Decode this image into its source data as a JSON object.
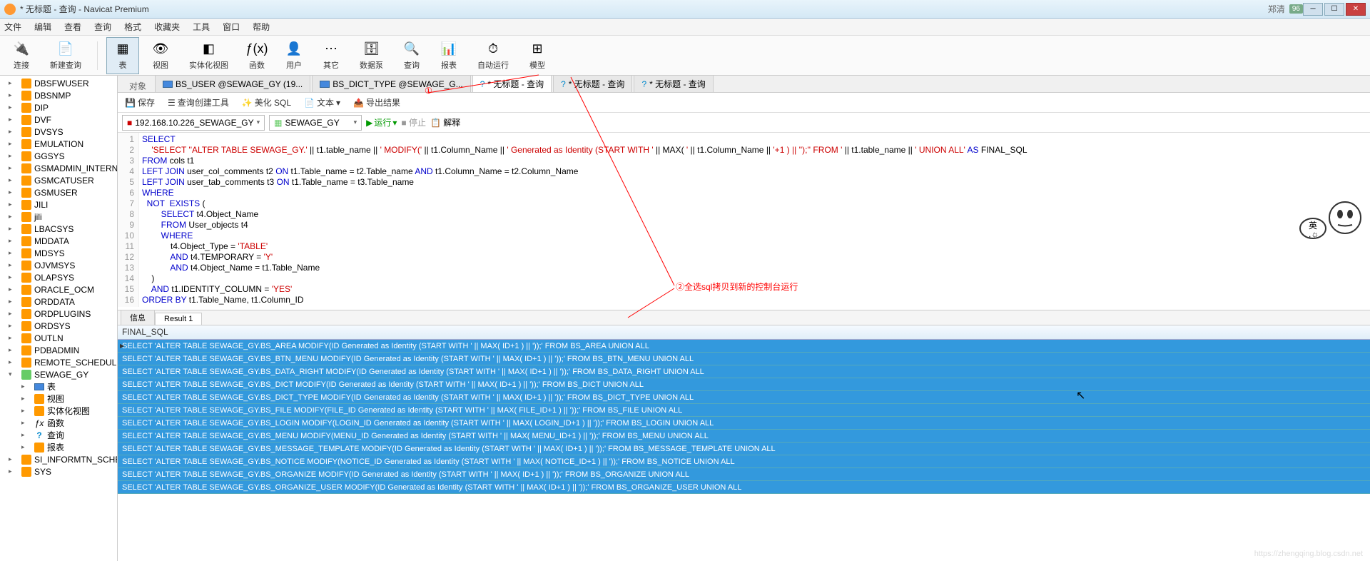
{
  "window": {
    "title": "* 无标题 - 查询 - Navicat Premium"
  },
  "menubar": [
    "文件",
    "编辑",
    "查看",
    "查询",
    "格式",
    "收藏夹",
    "工具",
    "窗口",
    "帮助"
  ],
  "user": {
    "name": "郑清",
    "badge": "96"
  },
  "toolbar": [
    {
      "icon": "🔌",
      "label": "连接"
    },
    {
      "icon": "📄",
      "label": "新建查询"
    },
    {
      "icon": "▦",
      "label": "表",
      "active": true
    },
    {
      "icon": "👁",
      "label": "视图"
    },
    {
      "icon": "◧",
      "label": "实体化视图"
    },
    {
      "icon": "ƒ(x)",
      "label": "函数"
    },
    {
      "icon": "👤",
      "label": "用户"
    },
    {
      "icon": "⋯",
      "label": "其它"
    },
    {
      "icon": "🗄",
      "label": "数据泵"
    },
    {
      "icon": "🔍",
      "label": "查询"
    },
    {
      "icon": "📊",
      "label": "报表"
    },
    {
      "icon": "⏱",
      "label": "自动运行"
    },
    {
      "icon": "⊞",
      "label": "模型"
    }
  ],
  "sidebar": [
    {
      "label": "DBSFWUSER",
      "t": "db"
    },
    {
      "label": "DBSNMP",
      "t": "db"
    },
    {
      "label": "DIP",
      "t": "db"
    },
    {
      "label": "DVF",
      "t": "db"
    },
    {
      "label": "DVSYS",
      "t": "db"
    },
    {
      "label": "EMULATION",
      "t": "db"
    },
    {
      "label": "GGSYS",
      "t": "db"
    },
    {
      "label": "GSMADMIN_INTERN",
      "t": "db"
    },
    {
      "label": "GSMCATUSER",
      "t": "db"
    },
    {
      "label": "GSMUSER",
      "t": "db"
    },
    {
      "label": "JILI",
      "t": "db"
    },
    {
      "label": "jili",
      "t": "db"
    },
    {
      "label": "LBACSYS",
      "t": "db"
    },
    {
      "label": "MDDATA",
      "t": "db"
    },
    {
      "label": "MDSYS",
      "t": "db"
    },
    {
      "label": "OJVMSYS",
      "t": "db"
    },
    {
      "label": "OLAPSYS",
      "t": "db"
    },
    {
      "label": "ORACLE_OCM",
      "t": "db"
    },
    {
      "label": "ORDDATA",
      "t": "db"
    },
    {
      "label": "ORDPLUGINS",
      "t": "db"
    },
    {
      "label": "ORDSYS",
      "t": "db"
    },
    {
      "label": "OUTLN",
      "t": "db"
    },
    {
      "label": "PDBADMIN",
      "t": "db"
    },
    {
      "label": "REMOTE_SCHEDULE",
      "t": "db"
    },
    {
      "label": "SEWAGE_GY",
      "t": "schema",
      "expanded": true,
      "children": [
        {
          "label": "表",
          "t": "tbl",
          "exp": true
        },
        {
          "label": "视图",
          "t": "fld",
          "exp": true
        },
        {
          "label": "实体化视图",
          "t": "fld",
          "exp": true
        },
        {
          "label": "函数",
          "t": "fx",
          "exp": true
        },
        {
          "label": "查询",
          "t": "q",
          "exp": true
        },
        {
          "label": "报表",
          "t": "fld",
          "exp": true
        }
      ]
    },
    {
      "label": "SI_INFORMTN_SCHE",
      "t": "db"
    },
    {
      "label": "SYS",
      "t": "db"
    }
  ],
  "tabs": {
    "obj_label": "对象",
    "items": [
      {
        "label": "BS_USER @SEWAGE_GY (19...",
        "icon": "tbl"
      },
      {
        "label": "BS_DICT_TYPE @SEWAGE_G...",
        "icon": "tbl"
      },
      {
        "label": "* 无标题 - 查询",
        "icon": "q",
        "active": true
      },
      {
        "label": "* 无标题 - 查询",
        "icon": "q"
      },
      {
        "label": "* 无标题 - 查询",
        "icon": "q"
      }
    ]
  },
  "qtoolbar": {
    "save": "保存",
    "builder": "查询创建工具",
    "beautify": "美化 SQL",
    "text": "文本",
    "export": "导出结果"
  },
  "combos": {
    "conn": "192.168.10.226_SEWAGE_GY",
    "db": "SEWAGE_GY",
    "run": "运行",
    "stop": "停止",
    "explain": "解释"
  },
  "sql_lines": [
    {
      "n": 1,
      "html": "<span class='kw'>SELECT</span>"
    },
    {
      "n": 2,
      "html": "    <span class='str'>'SELECT ''ALTER TABLE SEWAGE_GY.'</span> || t1.table_name || <span class='str'>' MODIFY('</span> || t1.Column_Name || <span class='str'>' Generated as Identity (START WITH '</span> || MAX( <span class='str'>'</span> || t1.Column_Name || <span class='str'>'+1 ) || '');'' FROM '</span> || t1.table_name || <span class='str'>' UNION ALL'</span> <span class='kw'>AS</span> FINAL_SQL"
    },
    {
      "n": 3,
      "html": "<span class='kw'>FROM</span> cols t1"
    },
    {
      "n": 4,
      "html": "<span class='kw'>LEFT JOIN</span> user_col_comments t2 <span class='kw'>ON</span> t1.Table_name = t2.Table_name <span class='kw'>AND</span> t1.Column_Name = t2.Column_Name"
    },
    {
      "n": 5,
      "html": "<span class='kw'>LEFT JOIN</span> user_tab_comments t3 <span class='kw'>ON</span> t1.Table_name = t3.Table_name"
    },
    {
      "n": 6,
      "html": "<span class='kw'>WHERE</span>"
    },
    {
      "n": 7,
      "html": "  <span class='kw'>NOT</span>  <span class='kw'>EXISTS</span> ("
    },
    {
      "n": 8,
      "html": "        <span class='kw'>SELECT</span> t4.Object_Name"
    },
    {
      "n": 9,
      "html": "        <span class='kw'>FROM</span> User_objects t4"
    },
    {
      "n": 10,
      "html": "        <span class='kw'>WHERE</span>"
    },
    {
      "n": 11,
      "html": "            t4.Object_Type = <span class='str'>'TABLE'</span>"
    },
    {
      "n": 12,
      "html": "            <span class='kw'>AND</span> t4.TEMPORARY = <span class='str'>'Y'</span>"
    },
    {
      "n": 13,
      "html": "            <span class='kw'>AND</span> t4.Object_Name = t1.Table_Name"
    },
    {
      "n": 14,
      "html": "    )"
    },
    {
      "n": 15,
      "html": "    <span class='kw'>AND</span> t1.IDENTITY_COLUMN = <span class='str'>'YES'</span>"
    },
    {
      "n": 16,
      "html": "<span class='kw'>ORDER BY</span> t1.Table_Name, t1.Column_ID"
    }
  ],
  "result_tabs": {
    "info": "信息",
    "result": "Result 1"
  },
  "result_header": "FINAL_SQL",
  "result_rows": [
    "SELECT 'ALTER TABLE SEWAGE_GY.BS_AREA MODIFY(ID Generated as Identity (START WITH ' || MAX( ID+1 ) || '));' FROM BS_AREA UNION ALL",
    "SELECT 'ALTER TABLE SEWAGE_GY.BS_BTN_MENU MODIFY(ID Generated as Identity (START WITH ' || MAX( ID+1 ) || '));' FROM BS_BTN_MENU UNION ALL",
    "SELECT 'ALTER TABLE SEWAGE_GY.BS_DATA_RIGHT MODIFY(ID Generated as Identity (START WITH ' || MAX( ID+1 ) || '));' FROM BS_DATA_RIGHT UNION ALL",
    "SELECT 'ALTER TABLE SEWAGE_GY.BS_DICT MODIFY(ID Generated as Identity (START WITH ' || MAX( ID+1 ) || '));' FROM BS_DICT UNION ALL",
    "SELECT 'ALTER TABLE SEWAGE_GY.BS_DICT_TYPE MODIFY(ID Generated as Identity (START WITH ' || MAX( ID+1 ) || '));' FROM BS_DICT_TYPE UNION ALL",
    "SELECT 'ALTER TABLE SEWAGE_GY.BS_FILE MODIFY(FILE_ID Generated as Identity (START WITH ' || MAX( FILE_ID+1 ) || '));' FROM BS_FILE UNION ALL",
    "SELECT 'ALTER TABLE SEWAGE_GY.BS_LOGIN MODIFY(LOGIN_ID Generated as Identity (START WITH ' || MAX( LOGIN_ID+1 ) || '));' FROM BS_LOGIN UNION ALL",
    "SELECT 'ALTER TABLE SEWAGE_GY.BS_MENU MODIFY(MENU_ID Generated as Identity (START WITH ' || MAX( MENU_ID+1 ) || '));' FROM BS_MENU UNION ALL",
    "SELECT 'ALTER TABLE SEWAGE_GY.BS_MESSAGE_TEMPLATE MODIFY(ID Generated as Identity (START WITH ' || MAX( ID+1 ) || '));' FROM BS_MESSAGE_TEMPLATE UNION ALL",
    "SELECT 'ALTER TABLE SEWAGE_GY.BS_NOTICE MODIFY(NOTICE_ID Generated as Identity (START WITH ' || MAX( NOTICE_ID+1 ) || '));' FROM BS_NOTICE UNION ALL",
    "SELECT 'ALTER TABLE SEWAGE_GY.BS_ORGANIZE MODIFY(ID Generated as Identity (START WITH ' || MAX( ID+1 ) || '));' FROM BS_ORGANIZE UNION ALL",
    "SELECT 'ALTER TABLE SEWAGE_GY.BS_ORGANIZE_USER MODIFY(ID Generated as Identity (START WITH ' || MAX( ID+1 ) || '));' FROM BS_ORGANIZE_USER UNION ALL"
  ],
  "annotations": {
    "a1": "①",
    "a2": "②全选sql拷贝到新的控制台运行"
  },
  "watermark": "https://zhengqing.blog.csdn.net"
}
